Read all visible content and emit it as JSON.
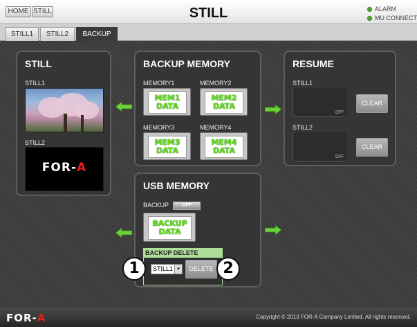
{
  "header": {
    "nav": [
      "HOME",
      "STILL"
    ],
    "title": "STILL",
    "indicators": [
      "ALARM",
      "MU CONNECT"
    ],
    "indicator_color": "#4aaa2a"
  },
  "tabs": [
    {
      "label": "STILL1",
      "active": false
    },
    {
      "label": "STILL2",
      "active": false
    },
    {
      "label": "BACKUP",
      "active": true
    }
  ],
  "still_panel": {
    "title": "STILL",
    "items": [
      {
        "label": "STILL1"
      },
      {
        "label": "STILL2"
      }
    ]
  },
  "backup_memory": {
    "title": "BACKUP MEMORY",
    "memories": [
      {
        "label": "MEMORY1",
        "card_line1": "MEM1",
        "card_line2": "DATA"
      },
      {
        "label": "MEMORY2",
        "card_line1": "MEM2",
        "card_line2": "DATA"
      },
      {
        "label": "MEMORY3",
        "card_line1": "MEM3",
        "card_line2": "DATA"
      },
      {
        "label": "MEMORY4",
        "card_line1": "MEM4",
        "card_line2": "DATA"
      }
    ]
  },
  "resume": {
    "title": "RESUME",
    "items": [
      {
        "label": "STILL1",
        "state": "OFF",
        "button": "CLEAR"
      },
      {
        "label": "STILL2",
        "state": "OFF",
        "button": "CLEAR"
      }
    ]
  },
  "usb_memory": {
    "title": "USB MEMORY",
    "backup_label": "BACKUP",
    "backup_toggle": "OFF",
    "card_line1": "BACKUP",
    "card_line2": "DATA",
    "delete_header": "BACKUP DELETE",
    "select_value": "STILL1",
    "delete_button": "DELETE"
  },
  "callouts": [
    "1",
    "2"
  ],
  "footer": {
    "logo_main": "FOR-",
    "logo_accent": "A",
    "copyright": "Copyright © 2013 FOR-A Company Limited. All rights reserved."
  },
  "still2_logo": {
    "main": "FOR-",
    "accent": "A"
  },
  "colors": {
    "accent_green": "#66dd22",
    "delete_header_bg": "#aedd99",
    "logo_red": "#e02020"
  }
}
